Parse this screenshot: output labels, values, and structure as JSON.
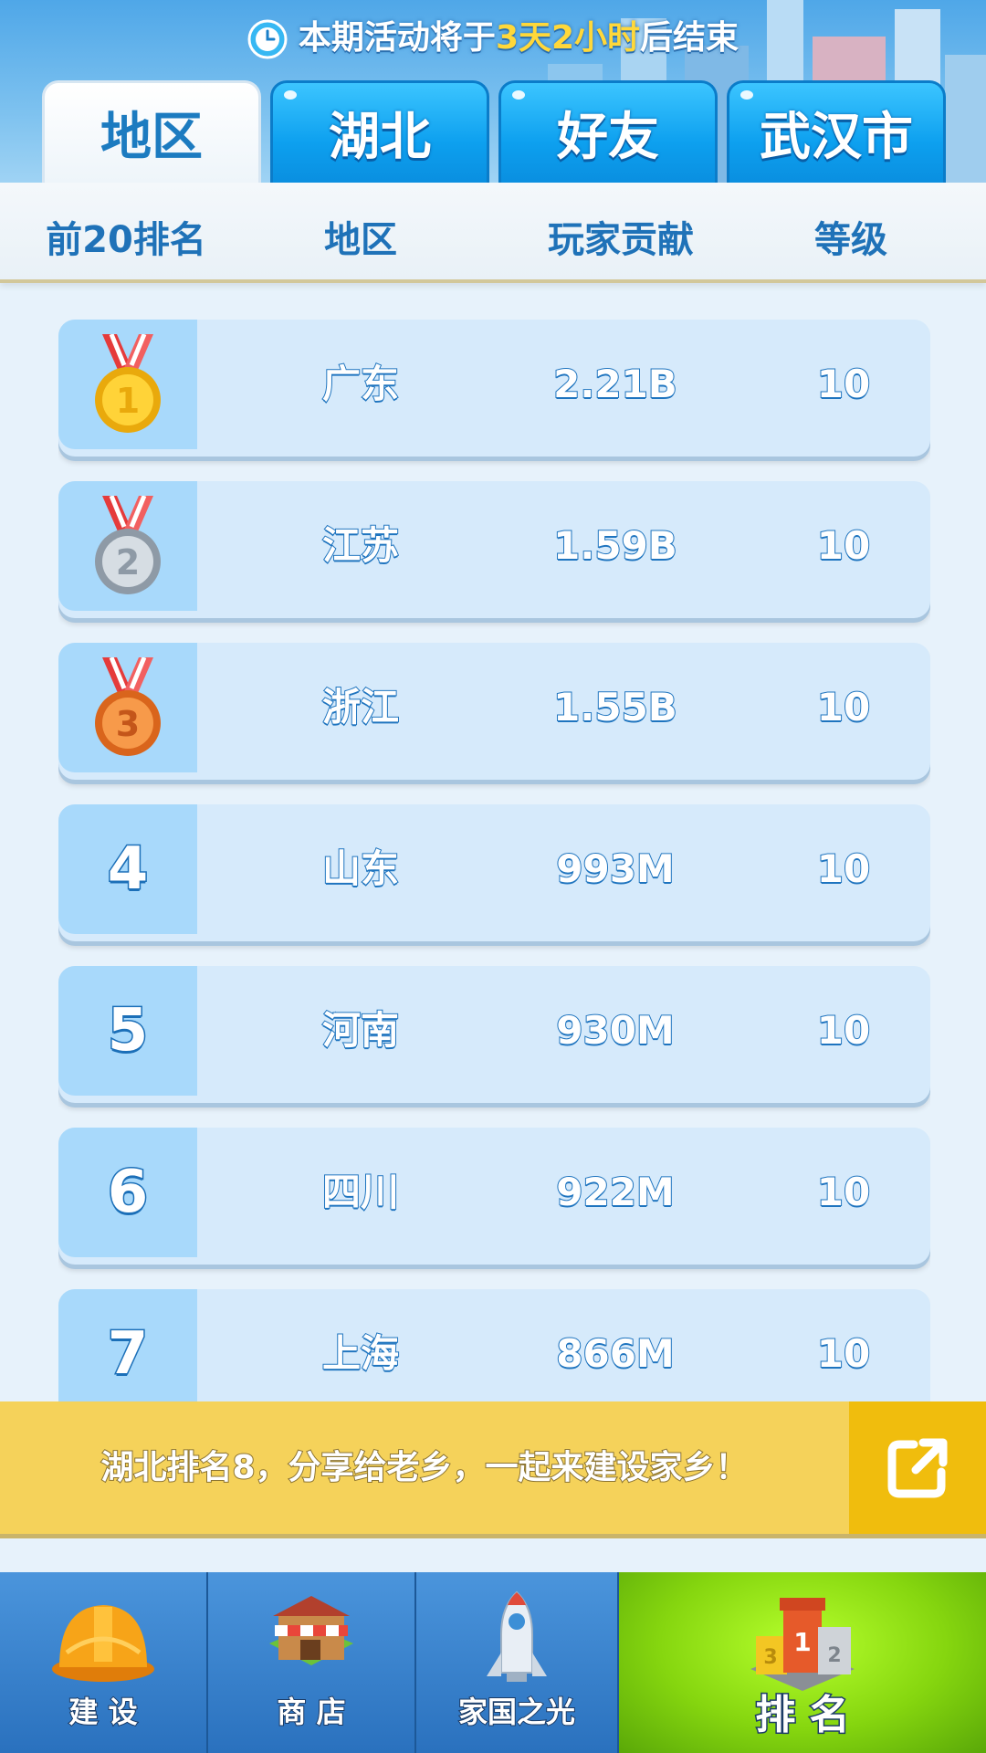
{
  "header": {
    "timer_prefix": "本期活动将于",
    "timer_highlight": "3天2小时",
    "timer_suffix": "后结束"
  },
  "tabs": [
    {
      "label": "地区",
      "active": true
    },
    {
      "label": "湖北",
      "active": false
    },
    {
      "label": "好友",
      "active": false
    },
    {
      "label": "武汉市",
      "active": false
    }
  ],
  "columns": {
    "rank": "前20排名",
    "region": "地区",
    "contribution": "玩家贡献",
    "level": "等级"
  },
  "rows": [
    {
      "rank": "1",
      "medal": "gold-medal-icon",
      "region": "广东",
      "contribution": "2.21B",
      "level": "10"
    },
    {
      "rank": "2",
      "medal": "silver-medal-icon",
      "region": "江苏",
      "contribution": "1.59B",
      "level": "10"
    },
    {
      "rank": "3",
      "medal": "bronze-medal-icon",
      "region": "浙江",
      "contribution": "1.55B",
      "level": "10"
    },
    {
      "rank": "4",
      "region": "山东",
      "contribution": "993M",
      "level": "10"
    },
    {
      "rank": "5",
      "region": "河南",
      "contribution": "930M",
      "level": "10"
    },
    {
      "rank": "6",
      "region": "四川",
      "contribution": "922M",
      "level": "10"
    },
    {
      "rank": "7",
      "region": "上海",
      "contribution": "866M",
      "level": "10"
    }
  ],
  "share": {
    "message": "湖北排名8，分享给老乡，一起来建设家乡！",
    "icon": "share-icon"
  },
  "nav": [
    {
      "label": "建 设",
      "icon": "hard-hat-icon",
      "active": false
    },
    {
      "label": "商 店",
      "icon": "shop-icon",
      "active": false
    },
    {
      "label": "家国之光",
      "icon": "rocket-icon",
      "active": false
    },
    {
      "label": "排 名",
      "icon": "podium-icon",
      "active": true
    }
  ],
  "colors": {
    "tab_blue": "#0da0ef",
    "text_blue": "#1e74bf",
    "row_bg": "#d6eafb",
    "share_bg": "#f5d25a",
    "nav_active": "#86d60f",
    "timer_highlight": "#ffd83a"
  }
}
